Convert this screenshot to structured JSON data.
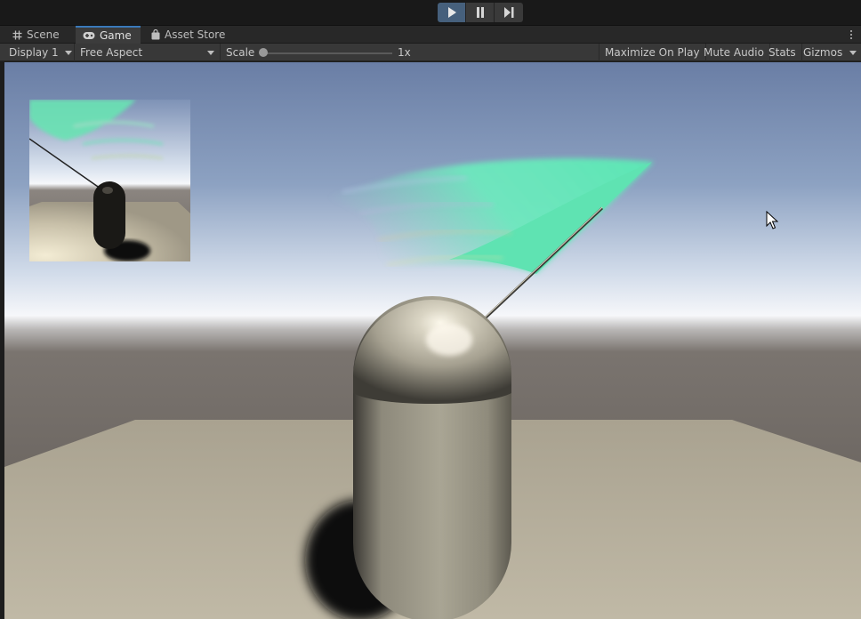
{
  "playbar": {
    "play_icon": "play-icon",
    "pause_icon": "pause-icon",
    "step_icon": "step-icon",
    "active_color": "#46607c"
  },
  "tabs": [
    {
      "label": "Scene",
      "icon": "grid-icon",
      "active": false
    },
    {
      "label": "Game",
      "icon": "gamepad-icon",
      "active": true
    },
    {
      "label": "Asset Store",
      "icon": "bag-icon",
      "active": false
    }
  ],
  "toolbar": {
    "display": "Display 1",
    "aspect": "Free Aspect",
    "scale_label": "Scale",
    "scale_value": "1x",
    "maximize": "Maximize On Play",
    "mute": "Mute Audio",
    "stats": "Stats",
    "gizmos": "Gizmos"
  },
  "scene": {
    "sky_top": "#6b7fa6",
    "horizon": "#f4f6fa",
    "ground_far": "#6e6862",
    "plane": "#b8b19c",
    "capsule": "#b9b4a3",
    "flag": "#63e6b8"
  }
}
